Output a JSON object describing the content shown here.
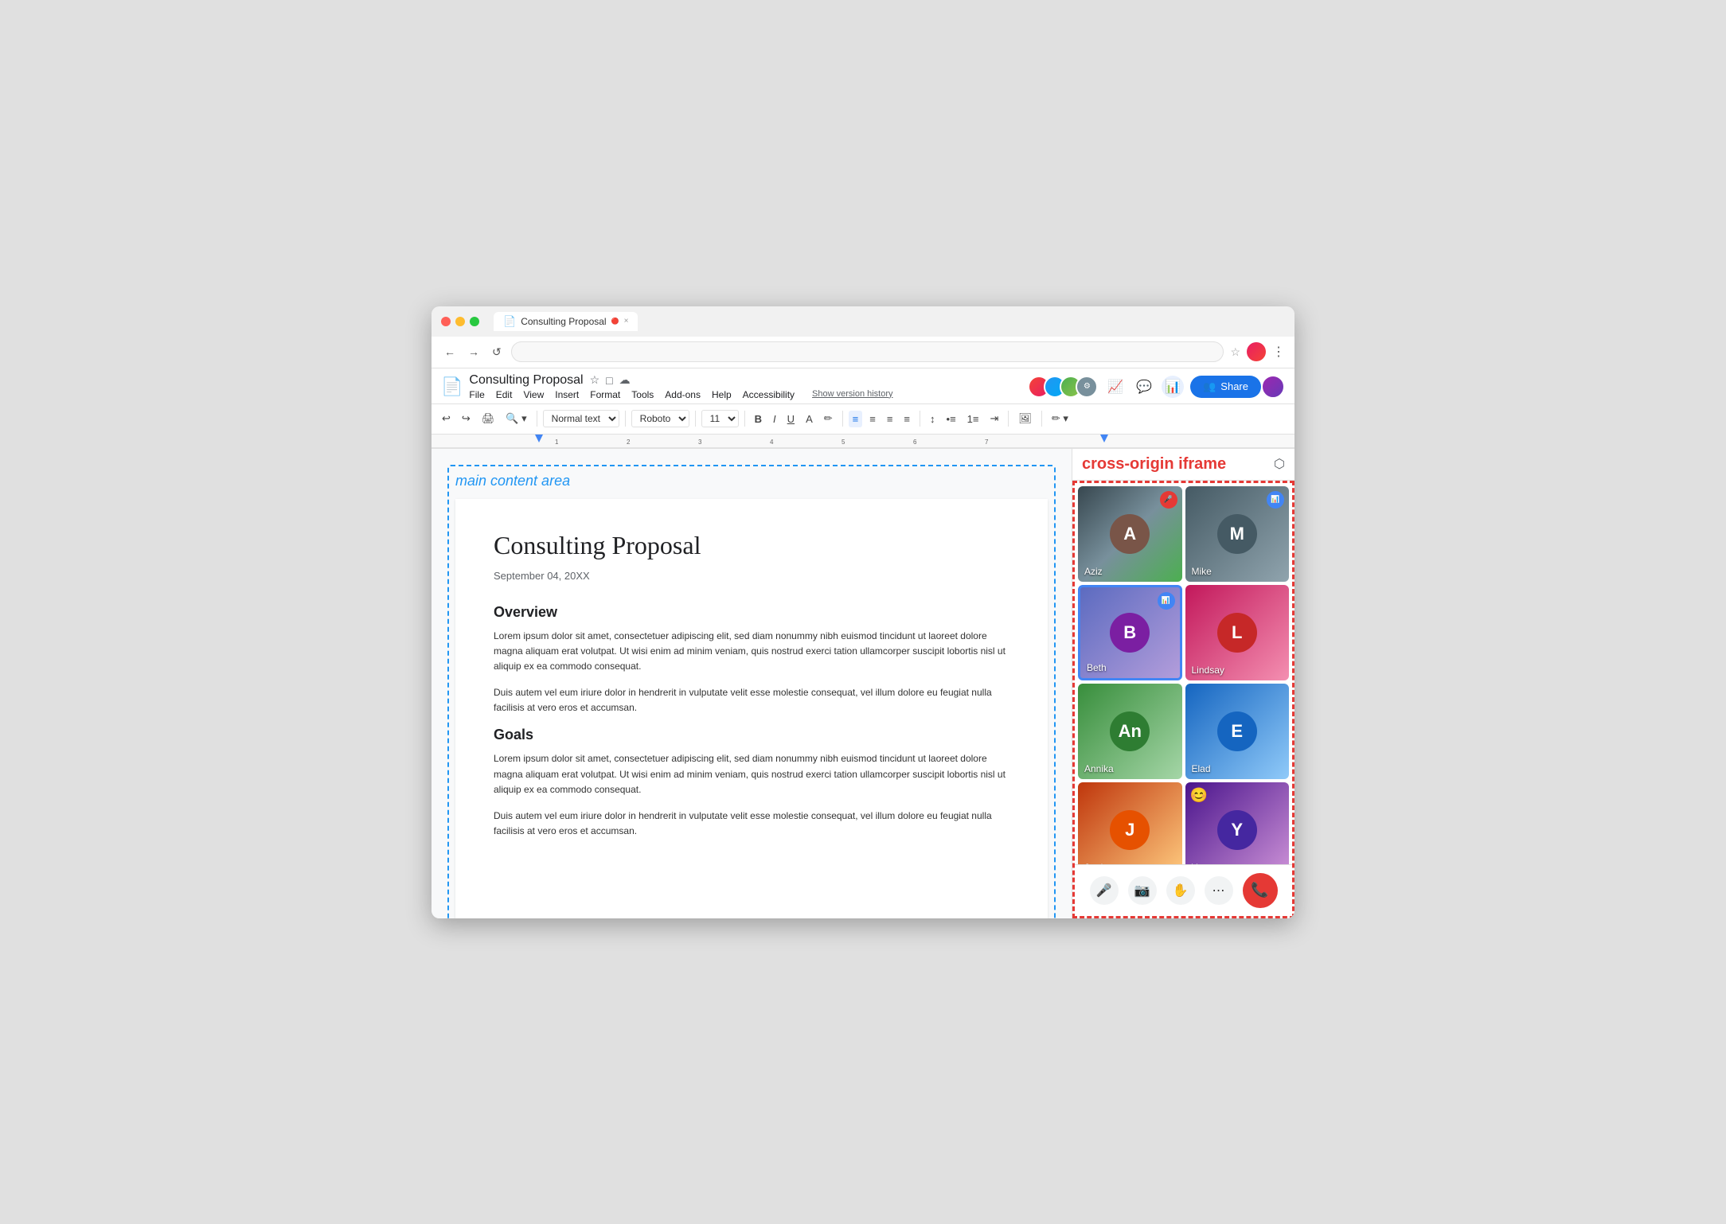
{
  "browser": {
    "tab_title": "Consulting Proposal",
    "tab_icon": "📄",
    "tab_close": "×",
    "traffic_lights": [
      "red",
      "yellow",
      "green"
    ],
    "url": "",
    "nav_buttons": [
      "←",
      "→",
      "↺"
    ]
  },
  "docs": {
    "icon": "📄",
    "title": "Consulting Proposal",
    "title_icons": [
      "☆",
      "□",
      "☁"
    ],
    "menu_items": [
      "File",
      "Edit",
      "View",
      "Insert",
      "Format",
      "Tools",
      "Add-ons",
      "Help",
      "Accessibility"
    ],
    "version_history": "Show version history",
    "share_label": "Share"
  },
  "toolbar": {
    "undo": "↩",
    "redo": "↪",
    "print": "🖨",
    "zoom": "🔍",
    "normal_text": "Normal text",
    "font": "Roboto",
    "size": "11",
    "bold": "B",
    "italic": "I",
    "underline": "U",
    "text_color": "A",
    "highlight": "✏",
    "align_left": "≡",
    "align_center": "≡",
    "align_right": "≡",
    "align_justify": "≡",
    "line_spacing": "↕",
    "bullet_list": "•≡",
    "numbered_list": "1≡",
    "image": "🖼",
    "pen": "✏"
  },
  "document": {
    "main_content_label": "main content area",
    "title": "Consulting Proposal",
    "date": "September 04, 20XX",
    "sections": [
      {
        "heading": "Overview",
        "paragraphs": [
          "Lorem ipsum dolor sit amet, consectetuer adipiscing elit, sed diam nonummy nibh euismod tincidunt ut laoreet dolore magna aliquam erat volutpat. Ut wisi enim ad minim veniam, quis nostrud exerci tation ullamcorper suscipit lobortis nisl ut aliquip ex ea commodo consequat.",
          "Duis autem vel eum iriure dolor in hendrerit in vulputate velit esse molestie consequat, vel illum dolore eu feugiat nulla facilisis at vero eros et accumsan."
        ]
      },
      {
        "heading": "Goals",
        "paragraphs": [
          "Lorem ipsum dolor sit amet, consectetuer adipiscing elit, sed diam nonummy nibh euismod tincidunt ut laoreet dolore magna aliquam erat volutpat. Ut wisi enim ad minim veniam, quis nostrud exerci tation ullamcorper suscipit lobortis nisl ut aliquip ex ea commodo consequat.",
          "Duis autem vel eum iriure dolor in hendrerit in vulputate velit esse molestie consequat, vel illum dolore eu feugiat nulla facilisis at vero eros et accumsan."
        ]
      }
    ]
  },
  "iframe": {
    "label": "cross-origin iframe",
    "open_icon": "⬡",
    "participants": [
      {
        "name": "Aziz",
        "bg": "bg-aziz",
        "face": "face-aziz",
        "initial": "A",
        "speaking": false,
        "muted_red": true
      },
      {
        "name": "Mike",
        "bg": "bg-mike",
        "face": "face-mike",
        "initial": "M",
        "speaking": true,
        "muted_red": false
      },
      {
        "name": "Beth",
        "bg": "bg-beth",
        "face": "face-beth",
        "initial": "B",
        "speaking": true,
        "muted_red": false,
        "active": true
      },
      {
        "name": "Lindsay",
        "bg": "bg-lindsay",
        "face": "face-lindsay",
        "initial": "L",
        "speaking": false,
        "muted_red": false
      },
      {
        "name": "Annika",
        "bg": "bg-annika",
        "face": "face-annika",
        "initial": "An",
        "speaking": false,
        "muted_red": false
      },
      {
        "name": "Elad",
        "bg": "bg-elad",
        "face": "face-elad",
        "initial": "E",
        "speaking": false,
        "muted_red": false
      },
      {
        "name": "Jordan",
        "bg": "bg-jordan",
        "face": "face-jordan",
        "initial": "J",
        "speaking": false,
        "muted_red": false
      },
      {
        "name": "You",
        "bg": "bg-you",
        "face": "face-you",
        "initial": "Y",
        "speaking": false,
        "muted_red": false,
        "has_emoji": true,
        "emoji": "😊"
      }
    ],
    "controls": {
      "mic": "🎤",
      "video": "📷",
      "hand": "✋",
      "more": "⋯",
      "end_call": "📞"
    }
  },
  "avatars": [
    "av1",
    "av2",
    "av3",
    "av4"
  ],
  "status": {
    "recording_dot": "🔴"
  }
}
